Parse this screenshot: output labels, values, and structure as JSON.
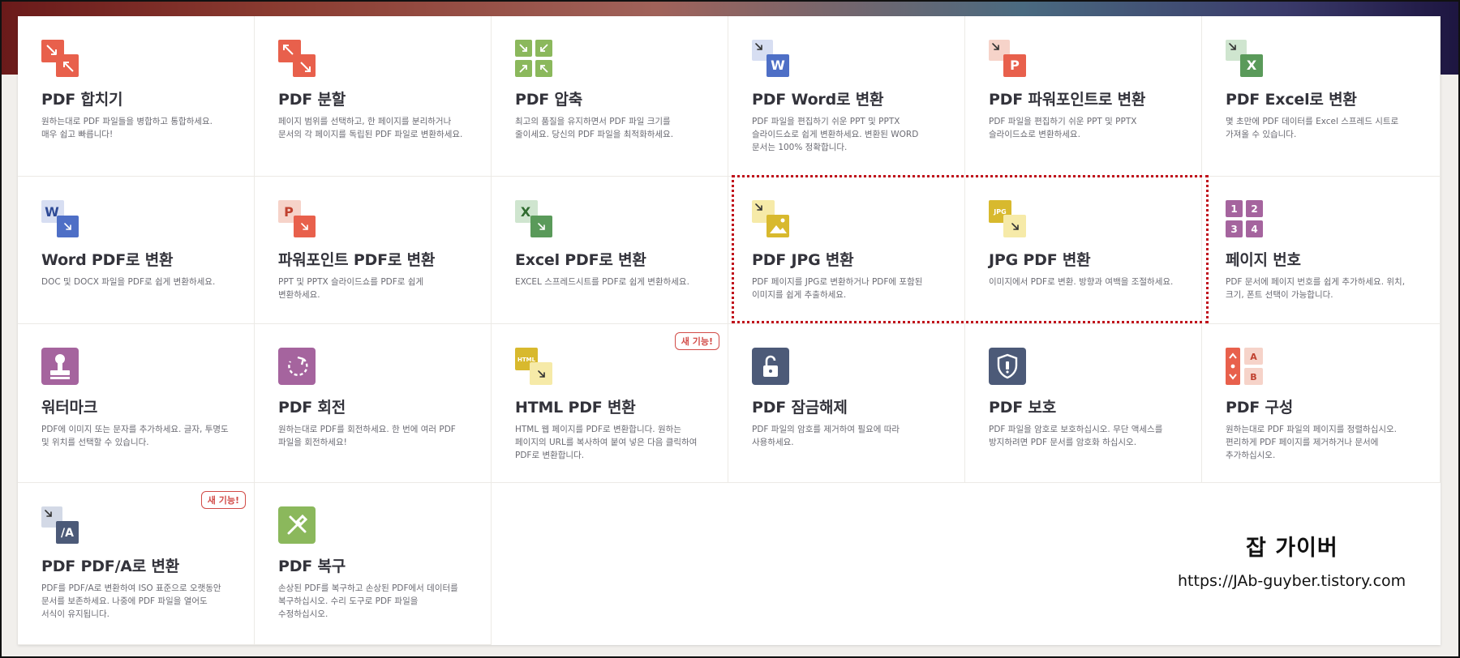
{
  "tools": [
    {
      "id": "merge",
      "title": "PDF 합치기",
      "desc": "원하는대로 PDF 파일들을 병합하고 통합하세요. 매우 쉽고 빠릅니다!",
      "icon": "merge-pdf-icon",
      "badge": ""
    },
    {
      "id": "split",
      "title": "PDF 분할",
      "desc": "페이지 범위를 선택하고, 한 페이지를 분리하거나 문서의 각 페이지를 독립된 PDF 파일로 변환하세요.",
      "icon": "split-pdf-icon",
      "badge": ""
    },
    {
      "id": "compress",
      "title": "PDF 압축",
      "desc": "최고의 품질을 유지하면서 PDF 파일 크기를 줄이세요. 당신의 PDF 파일을 최적화하세요.",
      "icon": "compress-pdf-icon",
      "badge": ""
    },
    {
      "id": "pdf-to-word",
      "title": "PDF Word로 변환",
      "desc": "PDF 파일을 편집하기 쉬운 PPT 및 PPTX 슬라이드쇼로 쉽게 변환하세요. 변환된 WORD 문서는 100% 정확합니다.",
      "icon": "pdf-to-word-icon",
      "badge": ""
    },
    {
      "id": "pdf-to-ppt",
      "title": "PDF 파워포인트로 변환",
      "desc": "PDF 파일을 편집하기 쉬운 PPT 및 PPTX 슬라이드쇼로 변환하세요.",
      "icon": "pdf-to-powerpoint-icon",
      "badge": ""
    },
    {
      "id": "pdf-to-excel",
      "title": "PDF Excel로 변환",
      "desc": "몇 초만에 PDF 데이터를 Excel 스프레드 시트로 가져올 수 있습니다.",
      "icon": "pdf-to-excel-icon",
      "badge": ""
    },
    {
      "id": "word-to-pdf",
      "title": "Word PDF로 변환",
      "desc": "DOC 및 DOCX 파일을 PDF로 쉽게 변환하세요.",
      "icon": "word-to-pdf-icon",
      "badge": ""
    },
    {
      "id": "ppt-to-pdf",
      "title": "파워포인트 PDF로 변환",
      "desc": "PPT 및 PPTX 슬라이드쇼를 PDF로 쉽게 변환하세요.",
      "icon": "powerpoint-to-pdf-icon",
      "badge": ""
    },
    {
      "id": "excel-to-pdf",
      "title": "Excel PDF로 변환",
      "desc": "EXCEL 스프레드시트를 PDF로 쉽게 변환하세요.",
      "icon": "excel-to-pdf-icon",
      "badge": ""
    },
    {
      "id": "pdf-to-jpg",
      "title": "PDF JPG 변환",
      "desc": "PDF 페이지를 JPG로 변환하거나 PDF에 포함된 이미지를 쉽게 추출하세요.",
      "icon": "pdf-to-jpg-icon",
      "badge": ""
    },
    {
      "id": "jpg-to-pdf",
      "title": "JPG PDF 변환",
      "desc": "이미지에서 PDF로 변환. 방향과 여백을 조절하세요.",
      "icon": "jpg-to-pdf-icon",
      "badge": ""
    },
    {
      "id": "page-numbers",
      "title": "페이지 번호",
      "desc": "PDF 문서에 페이지 번호를 쉽게 추가하세요. 위치, 크기, 폰트 선택이 가능합니다.",
      "icon": "page-numbers-icon",
      "badge": ""
    },
    {
      "id": "watermark",
      "title": "워터마크",
      "desc": "PDF에 이미지 또는 문자를 추가하세요. 글자, 투명도 및 위치를 선택할 수 있습니다.",
      "icon": "watermark-stamp-icon",
      "badge": ""
    },
    {
      "id": "rotate",
      "title": "PDF 회전",
      "desc": "원하는대로 PDF를 회전하세요. 한 번에 여러 PDF 파일을 회전하세요!",
      "icon": "rotate-icon",
      "badge": ""
    },
    {
      "id": "html-to-pdf",
      "title": "HTML PDF 변환",
      "desc": "HTML 웹 페이지를 PDF로 변환합니다. 원하는 페이지의 URL를 복사하여 붙여 넣은 다음 클릭하여 PDF로 변환합니다.",
      "icon": "html-to-pdf-icon",
      "badge": "새 기능!"
    },
    {
      "id": "unlock",
      "title": "PDF 잠금해제",
      "desc": "PDF 파일의 암호를 제거하여 필요에 따라 사용하세요.",
      "icon": "unlock-icon",
      "badge": ""
    },
    {
      "id": "protect",
      "title": "PDF 보호",
      "desc": "PDF 파일을 암호로 보호하십시오. 무단 액세스를 방지하려면 PDF 문서를 암호화 하십시오.",
      "icon": "shield-icon",
      "badge": ""
    },
    {
      "id": "organize",
      "title": "PDF 구성",
      "desc": "원하는대로 PDF 파일의 페이지를 정렬하십시오. 편리하게 PDF 페이지를 제거하거나 문서에 추가하십시오.",
      "icon": "organize-pages-icon",
      "badge": ""
    },
    {
      "id": "pdf-to-pdfa",
      "title": "PDF PDF/A로 변환",
      "desc": "PDF를 PDF/A로 변환하여 ISO 표준으로 오랫동안 문서를 보존하세요. 나중에 PDF 파일을 열어도 서식이 유지됩니다.",
      "icon": "pdf-to-pdfa-icon",
      "badge": "새 기능!"
    },
    {
      "id": "repair",
      "title": "PDF 복구",
      "desc": "손상된 PDF를 복구하고 손상된 PDF에서 데이터를 복구하십시오. 수리 도구로 PDF 파일을 수정하십시오.",
      "icon": "repair-tools-icon",
      "badge": ""
    }
  ],
  "icon_text": {
    "word": "W",
    "powerpoint": "P",
    "excel": "X",
    "jpg": "JPG",
    "html": "HTML",
    "pdfa": "/A",
    "page_numbers": [
      "1",
      "2",
      "3",
      "4"
    ],
    "organize": [
      "A",
      "B"
    ]
  },
  "watermark": {
    "title": "잡 가이버",
    "url": "https://JAb-guyber.tistory.com"
  },
  "colors": {
    "merge": "#e8604c",
    "compress": "#8bb85c",
    "word": "#4e6fc6",
    "powerpoint": "#e8604c",
    "excel": "#5a9a5a",
    "jpg": "#d8b92e",
    "violet": "#a5649e",
    "slate": "#4c5a78",
    "highlight": "#c0111b",
    "badge": "#d24b47"
  }
}
